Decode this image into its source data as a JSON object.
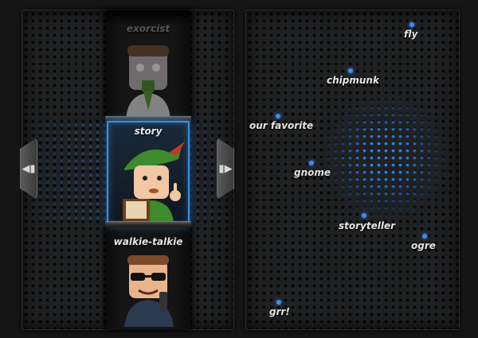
{
  "sounds": [
    {
      "label": "exorcist",
      "state": "inactive"
    },
    {
      "label": "story",
      "state": "selected"
    },
    {
      "label": "walkie-talkie",
      "state": "inactive"
    }
  ],
  "cloud_words": [
    "fly",
    "chipmunk",
    "our favorite",
    "gnome",
    "storyteller",
    "ogre",
    "grr!"
  ],
  "colors": {
    "accent": "#3d8cf0",
    "panel": "#202122",
    "text": "#e4e4e4"
  },
  "icons": {
    "prev": "◀▮",
    "next": "▮▶"
  }
}
